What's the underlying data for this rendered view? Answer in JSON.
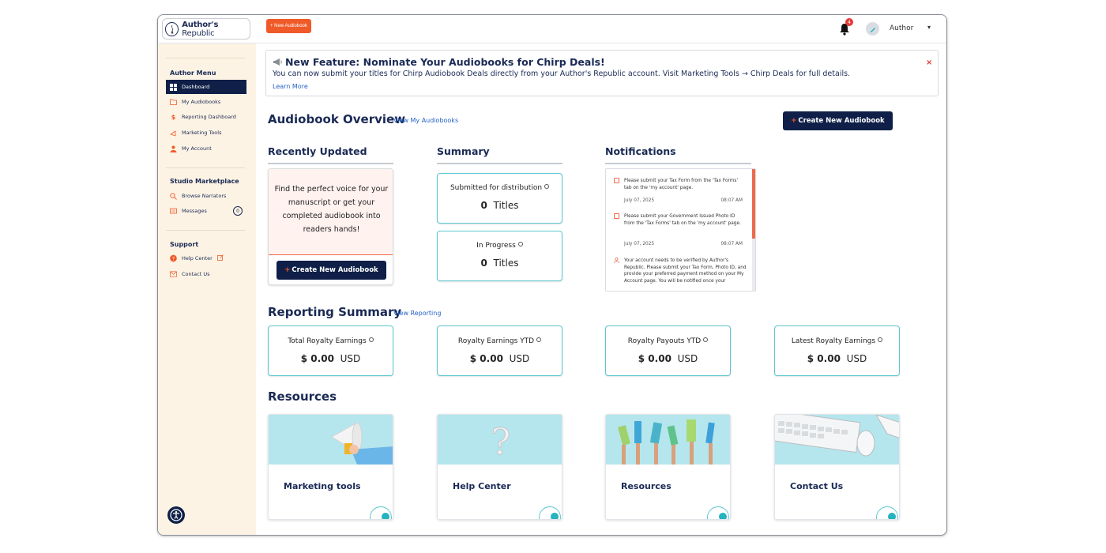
{
  "header": {
    "logo_text_bold": "Author's",
    "logo_text_light": " Republic",
    "new_audiobook_button": "+ New Audiobook",
    "notification_count": "4",
    "user_name": "Author",
    "user_chevron": "▾"
  },
  "sidebar": {
    "author_menu_title": "Author Menu",
    "author_items": [
      {
        "label": "Dashboard",
        "icon": "grid-icon"
      },
      {
        "label": "My Audiobooks",
        "icon": "folder-icon"
      },
      {
        "label": "Reporting Dashboard",
        "icon": "dollar-icon"
      },
      {
        "label": "Marketing Tools",
        "icon": "megaphone-icon"
      },
      {
        "label": "My Account",
        "icon": "user-icon"
      }
    ],
    "studio_title": "Studio Marketplace",
    "studio_items": [
      {
        "label": "Browse Narrators",
        "icon": "search-icon"
      },
      {
        "label": "Messages",
        "icon": "message-icon",
        "badge": "0"
      }
    ],
    "support_title": "Support",
    "support_items": [
      {
        "label": "Help Center",
        "icon": "help-icon"
      },
      {
        "label": "Contact Us",
        "icon": "mail-icon"
      }
    ]
  },
  "banner": {
    "title": "New Feature: Nominate Your Audiobooks for Chirp Deals!",
    "text": "You can now submit your titles for Chirp Audiobook Deals directly from your Author's Republic account. Visit Marketing Tools → Chirp Deals for full details.",
    "link": "Learn More",
    "close": "×"
  },
  "overview": {
    "title": "Audiobook Overview",
    "link": "View My Audiobooks",
    "create_button_plus": "+",
    "create_button": "Create New Audiobook"
  },
  "recently_updated": {
    "title": "Recently Updated",
    "promo_text": "Find the perfect voice for your manuscript or get your completed audiobook into readers hands!",
    "create_button_plus": "+",
    "create_button": "Create New Audiobook"
  },
  "summary": {
    "title": "Summary",
    "submitted_label": "Submitted for distribution",
    "submitted_value": "0",
    "submitted_unit": "Titles",
    "progress_label": "In Progress",
    "progress_value": "0",
    "progress_unit": "Titles"
  },
  "notifications": {
    "title": "Notifications",
    "items": [
      {
        "text": "Please submit your Tax Form from the 'Tax Forms' tab on the 'my account' page.",
        "date": "July 07, 2025",
        "time": "08:07 AM"
      },
      {
        "text": "Please submit your Government Issued Photo ID from the 'Tax Forms' tab on the 'my account' page.",
        "date": "July 07, 2025",
        "time": "08:07 AM"
      },
      {
        "text": "Your account needs to be verified by Author's Republic. Please submit your Tax Form, Photo ID, and provide your preferred payment method on your My Account page. You will be notified once your",
        "date": "",
        "time": ""
      }
    ]
  },
  "reporting": {
    "title": "Reporting Summary",
    "link": "View Reporting",
    "cards": [
      {
        "label": "Total Royalty Earnings",
        "amount": "$ 0.00",
        "currency": "USD"
      },
      {
        "label": "Royalty Earnings YTD",
        "amount": "$ 0.00",
        "currency": "USD"
      },
      {
        "label": "Royalty Payouts YTD",
        "amount": "$ 0.00",
        "currency": "USD"
      },
      {
        "label": "Latest Royalty Earnings",
        "amount": "$ 0.00",
        "currency": "USD"
      }
    ]
  },
  "resources": {
    "title": "Resources",
    "cards": [
      {
        "label": "Marketing tools",
        "image": "megaphone-image"
      },
      {
        "label": "Help Center",
        "image": "question-mark-image"
      },
      {
        "label": "Resources",
        "image": "raised-books-image"
      },
      {
        "label": "Contact Us",
        "image": "keyboard-mouse-image"
      }
    ]
  },
  "colors": {
    "navy": "#0f1f48",
    "orange": "#f05a28",
    "teal": "#5cc7d0",
    "sidebar_bg": "#fdf3e4",
    "link": "#2563c9"
  }
}
